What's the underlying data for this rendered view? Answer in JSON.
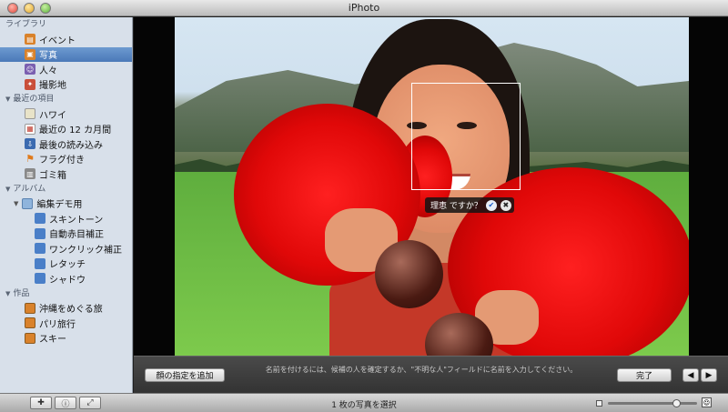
{
  "window": {
    "title": "iPhoto"
  },
  "sidebar": {
    "library": {
      "label": "ライブラリ",
      "items": [
        {
          "label": "イベント",
          "icon": "events-icon",
          "color": "#d9822b"
        },
        {
          "label": "写真",
          "icon": "photos-icon",
          "color": "#d9822b",
          "selected": true
        },
        {
          "label": "人々",
          "icon": "faces-icon",
          "color": "#7a5fb0"
        },
        {
          "label": "撮影地",
          "icon": "places-icon",
          "color": "#c94f3a"
        }
      ]
    },
    "recent": {
      "label": "最近の項目",
      "items": [
        {
          "label": "ハワイ",
          "icon": "event-thumb-icon",
          "color": "#e8e3c8"
        },
        {
          "label": "最近の 12 カ月間",
          "icon": "calendar-icon",
          "color": "#c0392b"
        },
        {
          "label": "最後の読み込み",
          "icon": "import-icon",
          "color": "#3a6ab0"
        },
        {
          "label": "フラグ付き",
          "icon": "flag-icon",
          "color": "#e07a1a"
        },
        {
          "label": "ゴミ箱",
          "icon": "trash-icon",
          "color": "#8a8a8a"
        }
      ]
    },
    "albums": {
      "label": "アルバム",
      "folder": {
        "label": "編集デモ用",
        "icon": "folder-icon"
      },
      "items": [
        {
          "label": "スキントーン",
          "icon": "album-icon"
        },
        {
          "label": "自動赤目補正",
          "icon": "album-icon"
        },
        {
          "label": "ワンクリック補正",
          "icon": "album-icon"
        },
        {
          "label": "レタッチ",
          "icon": "album-icon"
        },
        {
          "label": "シャドウ",
          "icon": "album-icon"
        }
      ]
    },
    "projects": {
      "label": "作品",
      "items": [
        {
          "label": "沖縄をめぐる旅",
          "icon": "project-icon"
        },
        {
          "label": "パリ旅行",
          "icon": "project-icon"
        },
        {
          "label": "スキー",
          "icon": "project-icon"
        }
      ]
    }
  },
  "viewer": {
    "face_prompt": "理恵 ですか？"
  },
  "infobar": {
    "add_name_label": "顔の指定を追加",
    "hint": "名前を付けるには、候補の人を確定するか、\"不明な人\"フィールドに名前を入力してください。",
    "done_label": "完了"
  },
  "toolbar": {
    "status": "1 枚の写真を選択",
    "zoom_level": 0.8
  },
  "colors": {
    "sidebar_bg": "#d8e0ea",
    "selection": "#4a79b8"
  }
}
